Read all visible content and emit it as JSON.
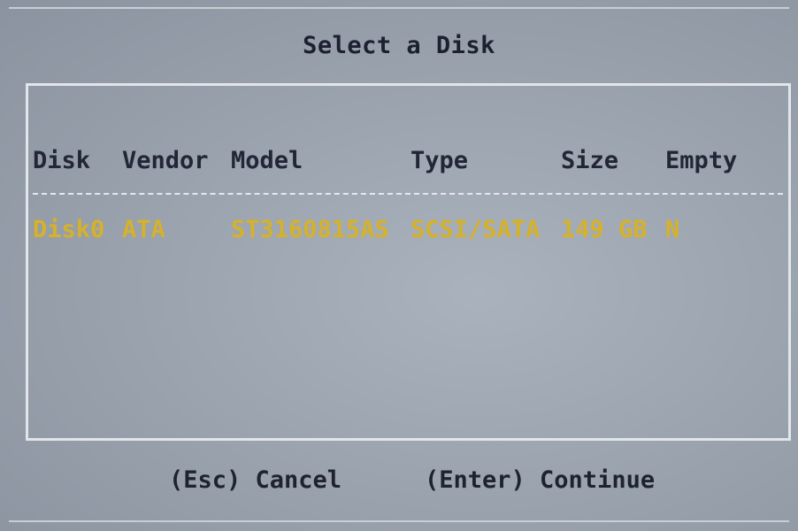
{
  "dialog": {
    "title": "Select a Disk",
    "columns": [
      "Disk",
      "Vendor",
      "Model",
      "Type",
      "Size",
      "Empty"
    ],
    "rows": [
      [
        "Disk0",
        "ATA",
        "ST3160815AS",
        "SCSI/SATA",
        "149 GB",
        "N"
      ]
    ],
    "selected_row_color": "#d6b12a"
  },
  "footer": {
    "cancel_label": "(Esc) Cancel",
    "continue_label": "(Enter) Continue"
  }
}
